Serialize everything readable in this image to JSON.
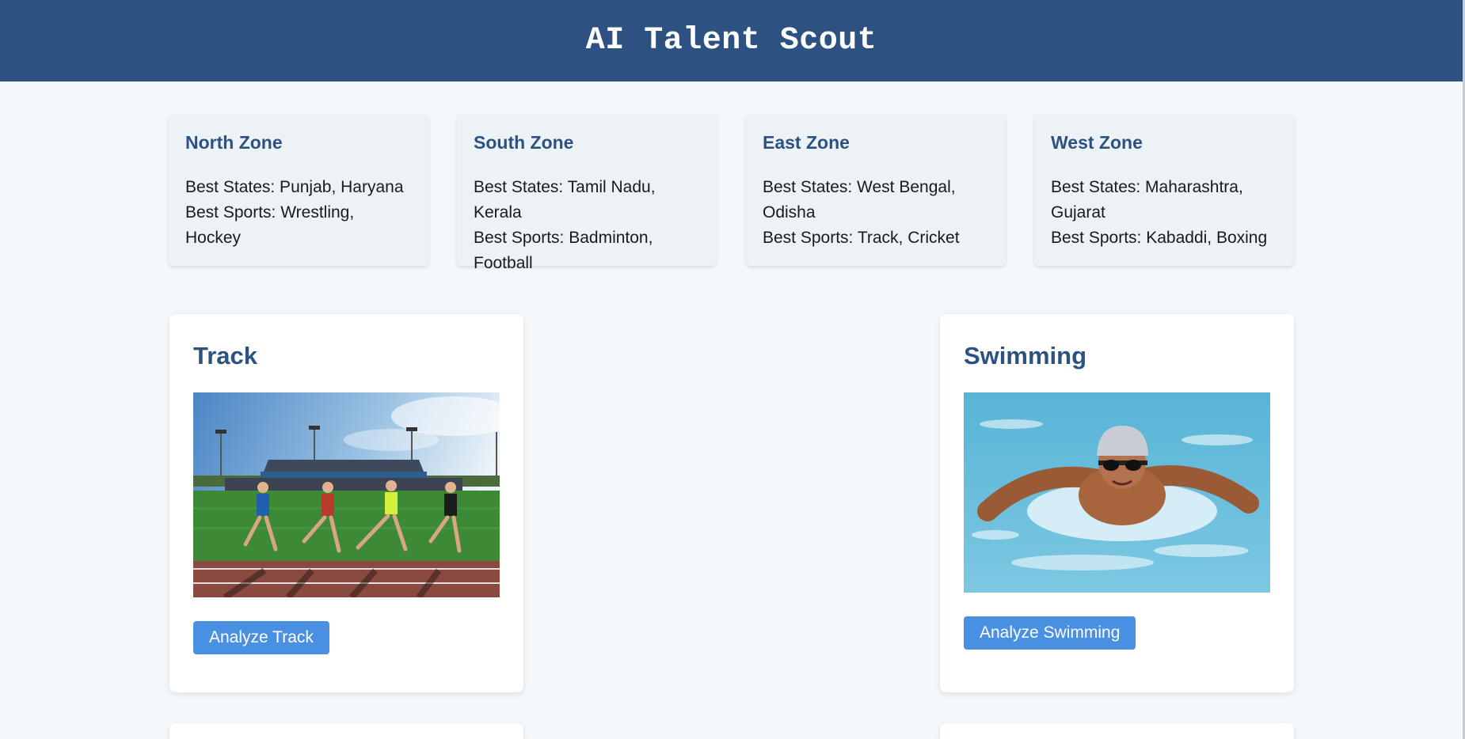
{
  "header": {
    "title": "AI Talent Scout"
  },
  "zones": [
    {
      "name": "North Zone",
      "states": "Best States: Punjab, Haryana",
      "sports": "Best Sports: Wrestling, Hockey"
    },
    {
      "name": "South Zone",
      "states": "Best States: Tamil Nadu, Kerala",
      "sports": "Best Sports: Badminton, Football"
    },
    {
      "name": "East Zone",
      "states": "Best States: West Bengal, Odisha",
      "sports": "Best Sports: Track, Cricket"
    },
    {
      "name": "West Zone",
      "states": "Best States: Maharashtra, Gujarat",
      "sports": "Best Sports: Kabaddi, Boxing"
    }
  ],
  "sports": [
    {
      "title": "Track",
      "button": "Analyze Track",
      "image": "track-runners-photo"
    },
    {
      "title": "Swimming",
      "button": "Analyze Swimming",
      "image": "swimmer-butterfly-photo"
    }
  ],
  "colors": {
    "header_bg": "#2d5282",
    "page_bg": "#f4f8fb",
    "zone_bg": "#edf2f7",
    "heading": "#2d5282",
    "button_bg": "#4a90e2"
  }
}
